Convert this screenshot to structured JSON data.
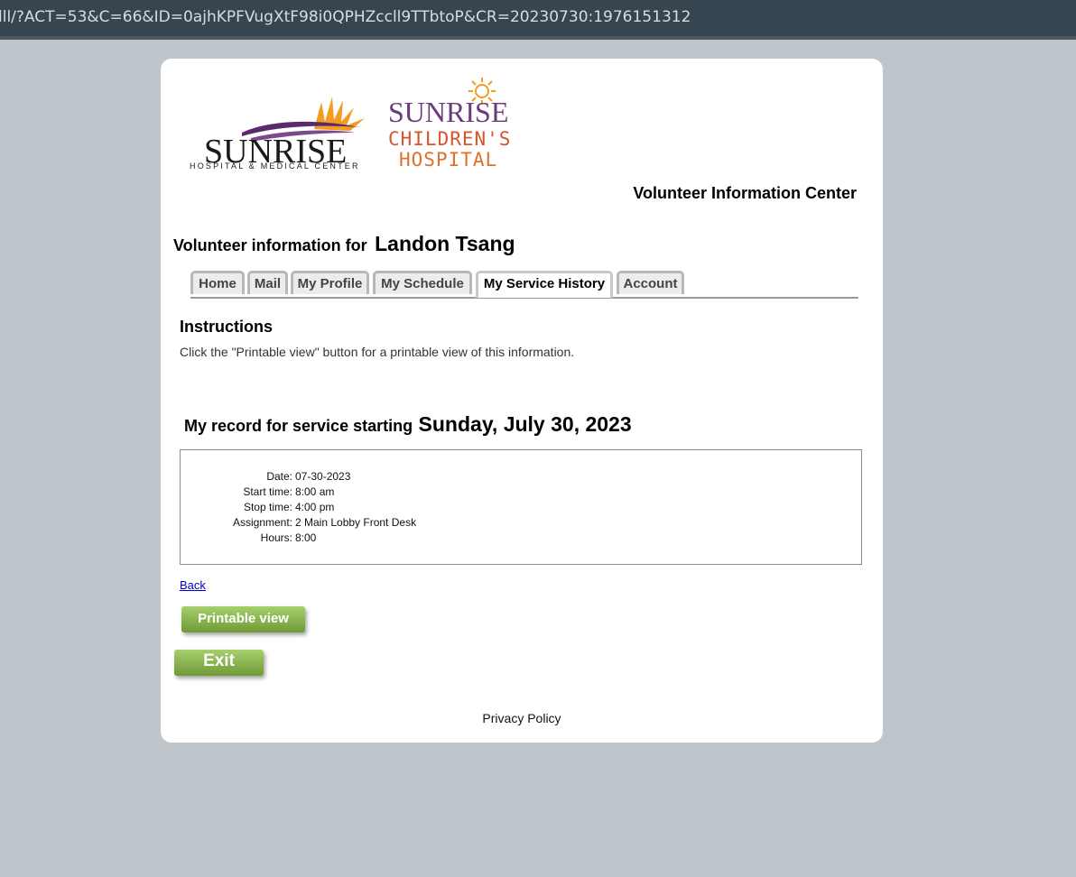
{
  "browser": {
    "url": "lll/?ACT=53&C=66&ID=0ajhKPFVugXtF98i0QPHZccll9TTbtoP&CR=20230730:1976151312"
  },
  "logos": {
    "hospital": {
      "name": "SUNRISE",
      "tagline": "HOSPITAL & MEDICAL CENTER"
    },
    "children": {
      "name": "SUNRISE",
      "line2": "CHILDREN'S",
      "line3": "HOSPITAL"
    }
  },
  "header": {
    "title": "Volunteer Information Center",
    "volunteer_label": "Volunteer information for",
    "volunteer_name": "Landon Tsang"
  },
  "tabs": [
    {
      "label": "Home",
      "active": false
    },
    {
      "label": "Mail",
      "active": false
    },
    {
      "label": "My Profile",
      "active": false
    },
    {
      "label": "My Schedule",
      "active": false
    },
    {
      "label": "My Service History",
      "active": true
    },
    {
      "label": "Account",
      "active": false
    }
  ],
  "instructions": {
    "heading": "Instructions",
    "text": "Click the \"Printable view\" button for a printable view of this information."
  },
  "record": {
    "heading_label": "My record for service starting",
    "heading_date": "Sunday, July 30, 2023",
    "fields": [
      {
        "label": "Date:",
        "value": "07-30-2023"
      },
      {
        "label": "Start time:",
        "value": "8:00 am"
      },
      {
        "label": "Stop time:",
        "value": "4:00 pm"
      },
      {
        "label": "Assignment:",
        "value": "2 Main Lobby Front Desk"
      },
      {
        "label": "Hours:",
        "value": "8:00"
      }
    ]
  },
  "actions": {
    "back_label": "Back",
    "printable_label": "Printable view",
    "exit_label": "Exit"
  },
  "footer": {
    "privacy_label": "Privacy Policy"
  },
  "colors": {
    "brand_purple": "#5b2a6e",
    "sun_orange": "#f29a1f",
    "button_green": "#7ea744",
    "page_bg": "#bec6cc"
  }
}
